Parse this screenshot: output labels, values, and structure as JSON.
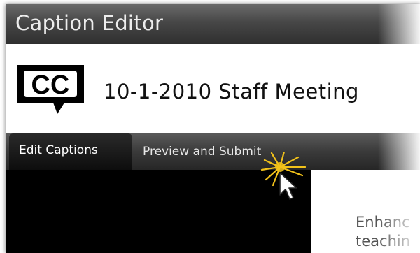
{
  "window": {
    "title": "Caption Editor"
  },
  "header": {
    "logo_icon": "closed-captions-icon",
    "logo_text": "CC",
    "meeting_title": "10-1-2010 Staff Meeting"
  },
  "tabs": [
    {
      "label": "Edit Captions",
      "active": true
    },
    {
      "label": "Preview and Submit",
      "active": false
    }
  ],
  "content": {
    "side_text_line1": "Enhanc",
    "side_text_line2": "teachin"
  },
  "cursor": {
    "icon": "mouse-pointer-icon",
    "effect": "click-burst-icon",
    "highlight_color": "#f2c21a"
  },
  "colors": {
    "titlebar": "#474747",
    "tab_active": "#0d0d0d",
    "video_bg": "#000000"
  }
}
